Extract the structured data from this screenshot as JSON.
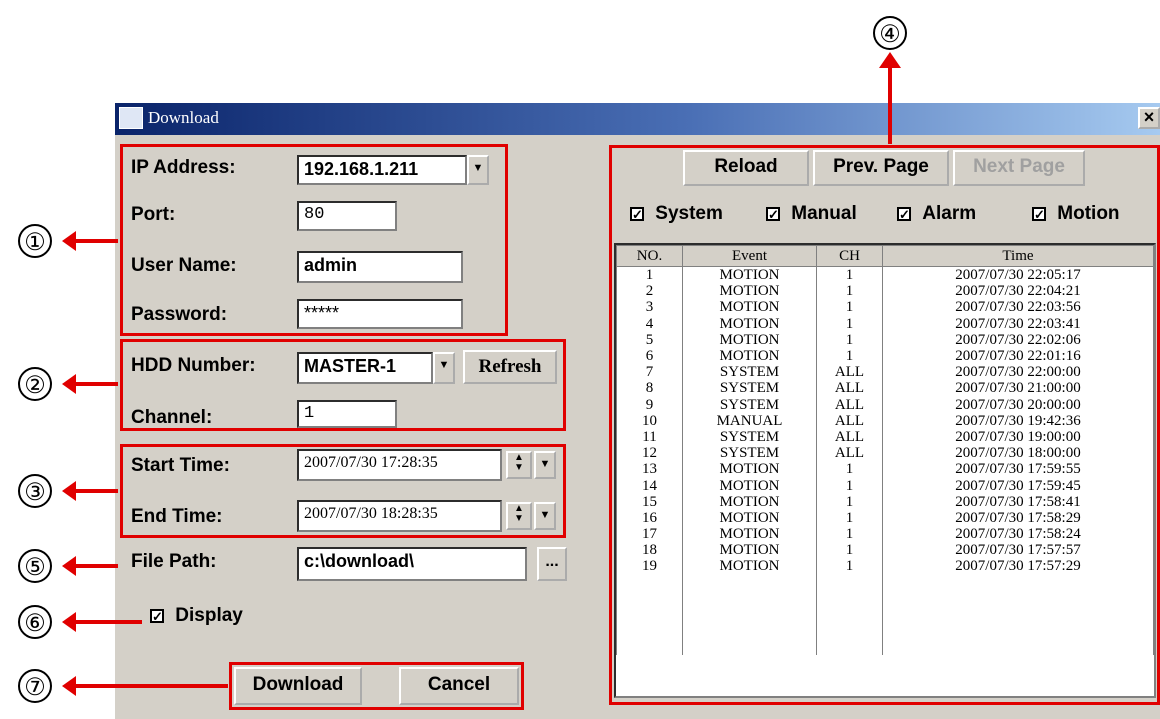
{
  "window": {
    "title": "Download",
    "close_label": "×"
  },
  "callouts": [
    "①",
    "②",
    "③",
    "④",
    "⑤",
    "⑥",
    "⑦"
  ],
  "form": {
    "ip_label": "IP Address:",
    "ip_value": "192.168.1.211",
    "port_label": "Port:",
    "port_value": "80",
    "user_label": "User Name:",
    "user_value": "admin",
    "pass_label": "Password:",
    "pass_value": "*****",
    "hdd_label": "HDD Number:",
    "hdd_value": "MASTER-1",
    "refresh_label": "Refresh",
    "channel_label": "Channel:",
    "channel_value": "1",
    "start_label": "Start Time:",
    "start_value": "2007/07/30 17:28:35",
    "end_label": "End Time:",
    "end_value": "2007/07/30 18:28:35",
    "path_label": "File Path:",
    "path_value": "c:\\download\\",
    "browse_label": "...",
    "display_label": "Display"
  },
  "actions": {
    "download": "Download",
    "cancel": "Cancel"
  },
  "log": {
    "reload": "Reload",
    "prev": "Prev. Page",
    "next": "Next Page",
    "filters": [
      "System",
      "Manual",
      "Alarm",
      "Motion"
    ],
    "columns": [
      "NO.",
      "Event",
      "CH",
      "Time"
    ],
    "rows": [
      [
        "1",
        "MOTION",
        "1",
        "2007/07/30 22:05:17"
      ],
      [
        "2",
        "MOTION",
        "1",
        "2007/07/30 22:04:21"
      ],
      [
        "3",
        "MOTION",
        "1",
        "2007/07/30 22:03:56"
      ],
      [
        "4",
        "MOTION",
        "1",
        "2007/07/30 22:03:41"
      ],
      [
        "5",
        "MOTION",
        "1",
        "2007/07/30 22:02:06"
      ],
      [
        "6",
        "MOTION",
        "1",
        "2007/07/30 22:01:16"
      ],
      [
        "7",
        "SYSTEM",
        "ALL",
        "2007/07/30 22:00:00"
      ],
      [
        "8",
        "SYSTEM",
        "ALL",
        "2007/07/30 21:00:00"
      ],
      [
        "9",
        "SYSTEM",
        "ALL",
        "2007/07/30 20:00:00"
      ],
      [
        "10",
        "MANUAL",
        "ALL",
        "2007/07/30 19:42:36"
      ],
      [
        "11",
        "SYSTEM",
        "ALL",
        "2007/07/30 19:00:00"
      ],
      [
        "12",
        "SYSTEM",
        "ALL",
        "2007/07/30 18:00:00"
      ],
      [
        "13",
        "MOTION",
        "1",
        "2007/07/30 17:59:55"
      ],
      [
        "14",
        "MOTION",
        "1",
        "2007/07/30 17:59:45"
      ],
      [
        "15",
        "MOTION",
        "1",
        "2007/07/30 17:58:41"
      ],
      [
        "16",
        "MOTION",
        "1",
        "2007/07/30 17:58:29"
      ],
      [
        "17",
        "MOTION",
        "1",
        "2007/07/30 17:58:24"
      ],
      [
        "18",
        "MOTION",
        "1",
        "2007/07/30 17:57:57"
      ],
      [
        "19",
        "MOTION",
        "1",
        "2007/07/30 17:57:29"
      ]
    ]
  },
  "colors": {
    "annotation_red": "#e00000",
    "title_bar": "#0a246a",
    "dialog_bg": "#d4d0c8"
  }
}
